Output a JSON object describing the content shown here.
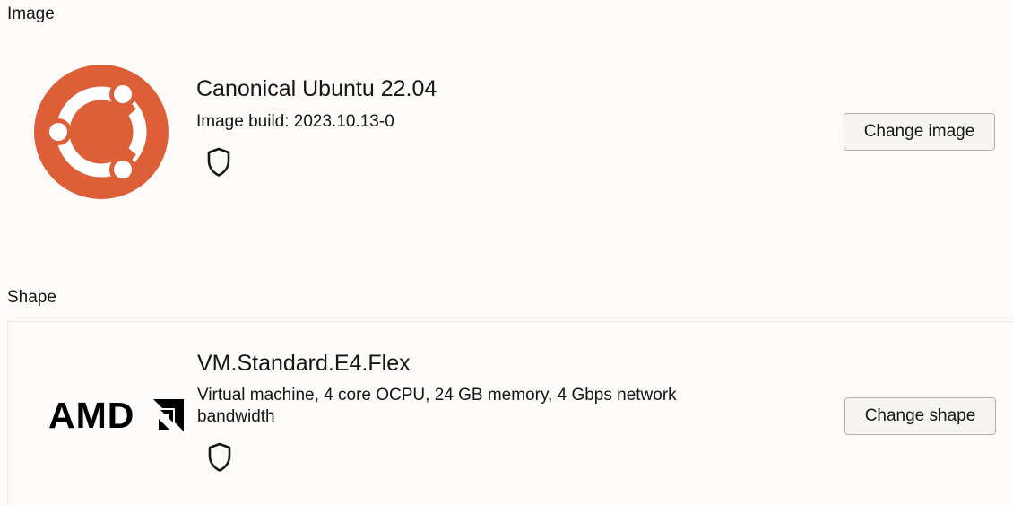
{
  "image_section": {
    "label": "Image",
    "title": "Canonical Ubuntu 22.04",
    "subtitle": "Image build: 2023.10.13-0",
    "logo_icon": "ubuntu-logo",
    "badge_icon": "shield-icon",
    "button_label": "Change image"
  },
  "shape_section": {
    "label": "Shape",
    "title": "VM.Standard.E4.Flex",
    "subtitle": "Virtual machine, 4 core OCPU, 24 GB memory, 4 Gbps network bandwidth",
    "logo_text": "AMD",
    "badge_icon": "shield-icon",
    "button_label": "Change shape"
  },
  "colors": {
    "ubuntu_orange": "#dd5f37",
    "text": "#161513",
    "background": "#fcfbfa",
    "button_bg": "#f6f5f3",
    "button_border": "#b4b1ac"
  }
}
